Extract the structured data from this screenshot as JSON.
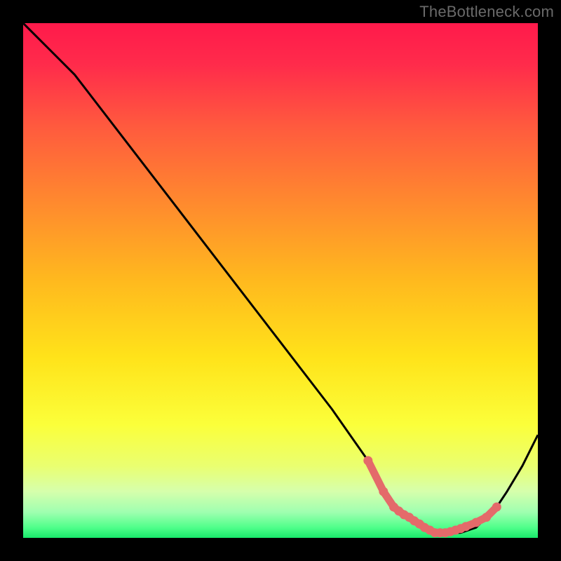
{
  "watermark": "TheBottleneck.com",
  "colors": {
    "dot": "#e46a6a",
    "line": "#000000"
  },
  "chart_data": {
    "type": "line",
    "title": "",
    "xlabel": "",
    "ylabel": "",
    "xlim": [
      0,
      100
    ],
    "ylim": [
      0,
      100
    ],
    "grid": false,
    "legend": false,
    "background": "heatmap-gradient red→yellow→green (vertical)",
    "series": [
      {
        "name": "curve",
        "x": [
          0,
          6,
          10,
          20,
          30,
          40,
          50,
          60,
          67,
          70,
          72,
          75,
          78,
          80,
          82,
          85,
          88,
          90,
          92,
          94,
          97,
          100
        ],
        "y": [
          100,
          94,
          90,
          77,
          64,
          51,
          38,
          25,
          15,
          9,
          6,
          4,
          2,
          1,
          1,
          1,
          2,
          4,
          6,
          9,
          14,
          20
        ]
      }
    ],
    "markers": {
      "name": "highlight-dots",
      "x": [
        67,
        70,
        72,
        73,
        74,
        75,
        76,
        77,
        78,
        79,
        80,
        81,
        82,
        83,
        84,
        85,
        86,
        88,
        90,
        92
      ],
      "y": [
        15,
        9,
        6,
        5.2,
        4.5,
        4,
        3.3,
        2.7,
        2,
        1.5,
        1,
        1,
        1,
        1.2,
        1.5,
        1.8,
        2.2,
        3,
        4,
        6
      ]
    }
  }
}
